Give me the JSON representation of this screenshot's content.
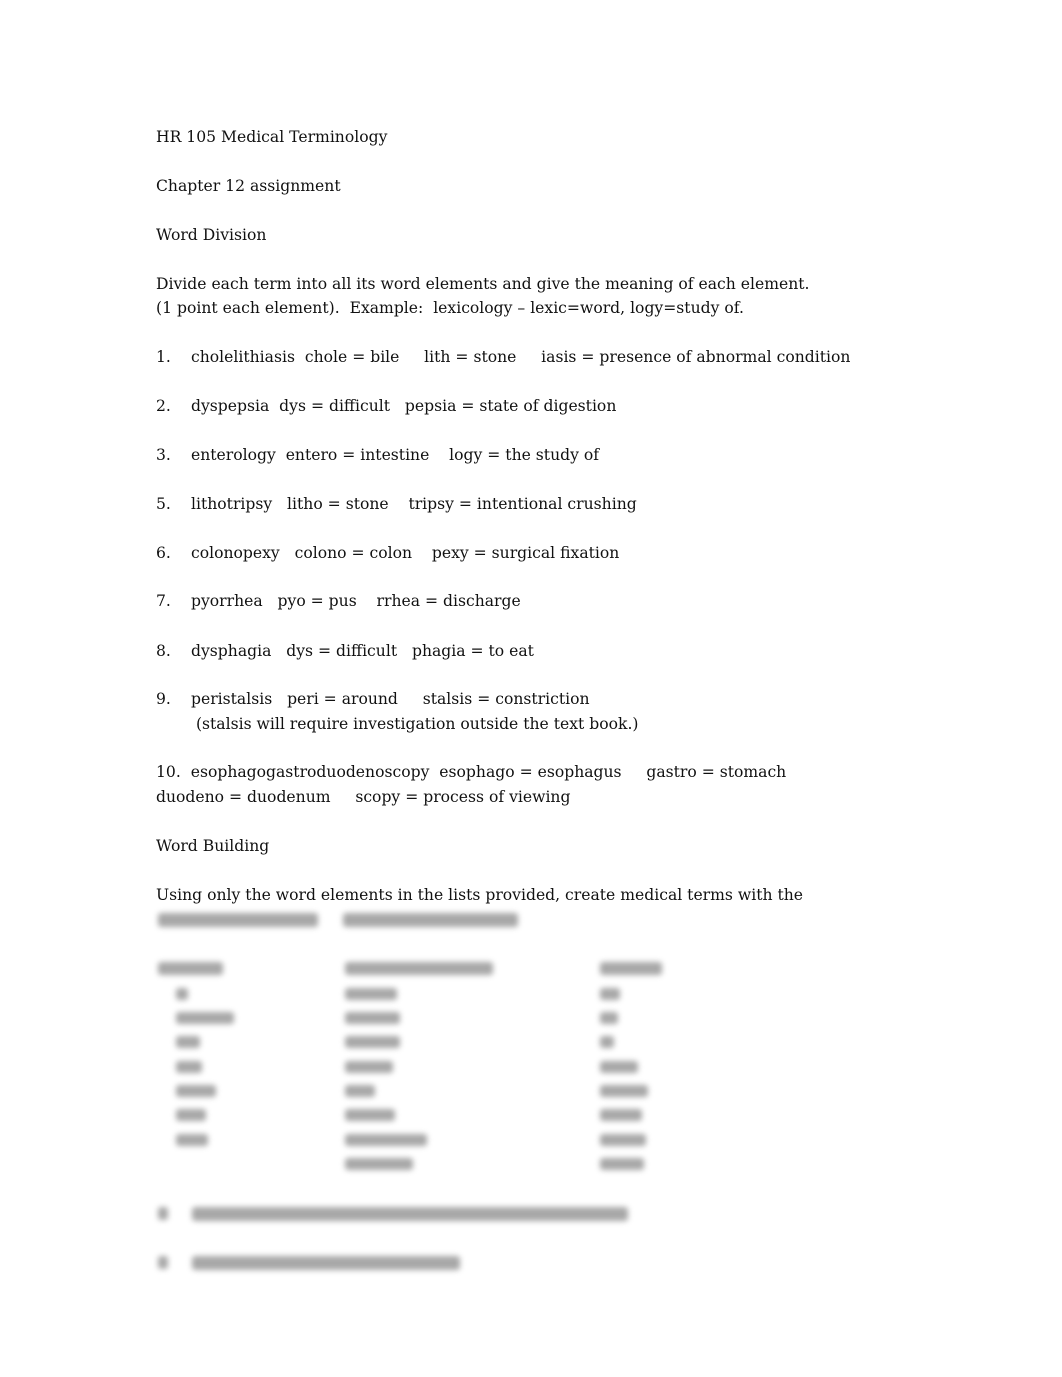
{
  "course_title": "HR 105 Medical Terminology",
  "assignment": "Chapter 12 assignment",
  "section1": {
    "heading": "Word Division",
    "instructions": [
      "Divide each term into all its word elements and give the meaning of each element.",
      "(1 point each element).  Example:  lexicology – lexic=word, logy=study of."
    ],
    "items": [
      {
        "num": "1.",
        "text": "cholelithiasis  chole = bile     lith = stone     iasis = presence of abnormal condition"
      },
      {
        "num": "2.",
        "text": "dyspepsia  dys = difficult   pepsia = state of digestion"
      },
      {
        "num": "3.",
        "text": "enterology  entero = intestine    logy = the study of"
      },
      {
        "num": "5.",
        "text": "lithotripsy   litho = stone    tripsy = intentional crushing"
      },
      {
        "num": "6.",
        "text": "colonopexy   colono = colon    pexy = surgical fixation"
      },
      {
        "num": "7.",
        "text": "pyorrhea   pyo = pus    rrhea = discharge"
      },
      {
        "num": "8.",
        "text": "dysphagia   dys = difficult   phagia = to eat"
      },
      {
        "num": "9.",
        "text": "peristalsis   peri = around     stalsis = constriction",
        "note": " (stalsis will require investigation outside the text book.)"
      }
    ],
    "item10": {
      "line1": "10.  esophagogastroduodenoscopy  esophago = esophagus     gastro = stomach",
      "line2": "duodeno = duodenum     scopy = process of viewing"
    }
  },
  "section2": {
    "heading": "Word Building",
    "instructions": "Using only the word elements in the lists provided, create medical terms with the"
  }
}
